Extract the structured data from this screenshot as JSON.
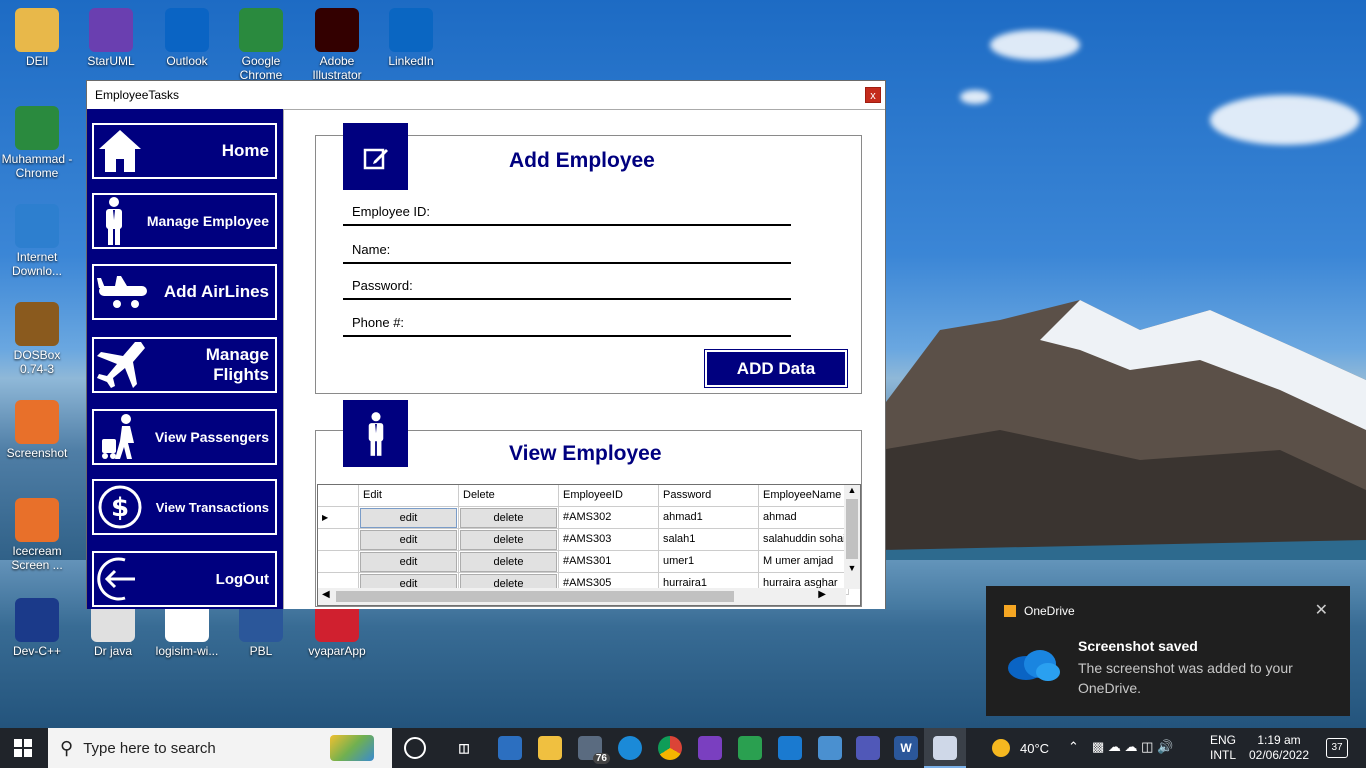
{
  "desktop": {
    "icons": [
      {
        "label": "DEll",
        "icon": "folder-user-icon",
        "color": "#e8b84a"
      },
      {
        "label": "StarUML",
        "icon": "star-icon",
        "color": "#6a3fb0"
      },
      {
        "label": "Outlook",
        "icon": "outlook-icon",
        "color": "#0a64c4"
      },
      {
        "label": "Google Chrome",
        "icon": "chrome-icon",
        "color": "#2a8a3e"
      },
      {
        "label": "Adobe Illustrator",
        "icon": "illustrator-icon",
        "color": "#330000"
      },
      {
        "label": "LinkedIn",
        "icon": "linkedin-icon",
        "color": "#0a66c2"
      },
      {
        "label": "Muhammad - Chrome",
        "icon": "chrome-icon",
        "color": "#2a8a3e"
      },
      {
        "label": "Internet Downlo...",
        "icon": "globe-icon",
        "color": "#2d7fcf"
      },
      {
        "label": "DOSBox 0.74-3",
        "icon": "dosbox-icon",
        "color": "#8a5a1e"
      },
      {
        "label": "Screenshot",
        "icon": "camera-icon",
        "color": "#e8702a"
      },
      {
        "label": "Icecream Screen ...",
        "icon": "icecream-icon",
        "color": "#e8702a"
      },
      {
        "label": "Dev-C++",
        "icon": "devcpp-icon",
        "color": "#1b3a8a"
      },
      {
        "label": "Dr java",
        "icon": "java-icon",
        "color": "#e0e0e0"
      },
      {
        "label": "logisim-wi...",
        "icon": "logic-gate-icon",
        "color": "#ffffff"
      },
      {
        "label": "PBL",
        "icon": "word-icon",
        "color": "#2b579a"
      },
      {
        "label": "vyaparApp",
        "icon": "vyapar-icon",
        "color": "#d0202f"
      }
    ]
  },
  "window": {
    "title": "EmployeeTasks",
    "close": "x"
  },
  "sidebar": {
    "items": [
      {
        "label": "Home",
        "icon": "home-icon"
      },
      {
        "label": "Manage Employee",
        "icon": "person-icon"
      },
      {
        "label": "Add AirLines",
        "icon": "airplane-side-icon"
      },
      {
        "label": "Manage Flights",
        "icon": "airplane-icon"
      },
      {
        "label": "View Passengers",
        "icon": "traveler-icon"
      },
      {
        "label": "View Transactions",
        "icon": "money-icon"
      },
      {
        "label": "LogOut",
        "icon": "logout-icon"
      }
    ]
  },
  "add_panel": {
    "title": "Add Employee",
    "fields": [
      "Employee ID:",
      "Name:",
      "Password:",
      "Phone #:"
    ],
    "submit": "ADD Data"
  },
  "view_panel": {
    "title": "View Employee",
    "columns": [
      "Edit",
      "Delete",
      "EmployeeID",
      "Password",
      "EmployeeName"
    ],
    "rows": [
      {
        "edit": "edit",
        "delete": "delete",
        "id": "#AMS302",
        "password": "ahmad1",
        "name": "ahmad"
      },
      {
        "edit": "edit",
        "delete": "delete",
        "id": "#AMS303",
        "password": "salah1",
        "name": "salahuddin sohail"
      },
      {
        "edit": "edit",
        "delete": "delete",
        "id": "#AMS301",
        "password": "umer1",
        "name": "M umer amjad"
      },
      {
        "edit": "edit",
        "delete": "delete",
        "id": "#AMS305",
        "password": "hurraira1",
        "name": "hurraira asghar"
      }
    ]
  },
  "toast": {
    "app": "OneDrive",
    "title": "Screenshot saved",
    "body": "The screenshot was added to your OneDrive."
  },
  "taskbar": {
    "search_placeholder": "Type here to search",
    "mail_badge": "76",
    "weather": "40°C",
    "lang1": "ENG",
    "lang2": "INTL",
    "time": "1:19 am",
    "date": "02/06/2022",
    "notif_count": "37"
  },
  "colors": {
    "navy": "#00007f",
    "taskbar": "#20242a"
  }
}
